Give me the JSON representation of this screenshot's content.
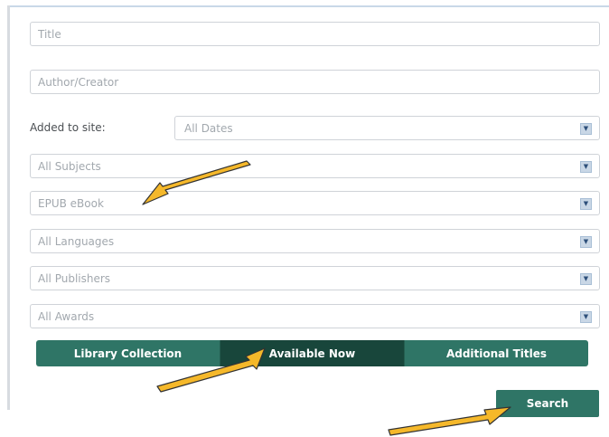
{
  "form": {
    "title_placeholder": "Title",
    "author_placeholder": "Author/Creator",
    "added_label": "Added to site:",
    "dates_value": "All Dates",
    "subjects_value": "All Subjects",
    "format_value": "EPUB eBook",
    "languages_value": "All Languages",
    "publishers_value": "All Publishers",
    "awards_value": "All Awards"
  },
  "tabs": [
    {
      "label": "Library Collection",
      "active": false
    },
    {
      "label": "Available Now",
      "active": true
    },
    {
      "label": "Additional Titles",
      "active": false
    }
  ],
  "search_label": "Search",
  "colors": {
    "accent": "#2f7566",
    "accent_active": "#18463b",
    "arrow_fill": "#f5b82a"
  },
  "icons": {
    "dropdown": "chevron-down-icon",
    "annotation": "arrow-icon"
  }
}
